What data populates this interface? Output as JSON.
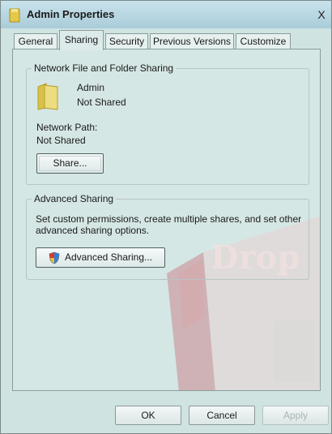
{
  "window": {
    "title": "Admin Properties",
    "close_glyph": "X"
  },
  "tabs": [
    {
      "label": "General",
      "active": false
    },
    {
      "label": "Sharing",
      "active": true
    },
    {
      "label": "Security",
      "active": false
    },
    {
      "label": "Previous Versions",
      "active": false
    },
    {
      "label": "Customize",
      "active": false
    }
  ],
  "network_sharing": {
    "group_title": "Network File and Folder Sharing",
    "folder_name": "Admin",
    "folder_status": "Not Shared",
    "network_path_label": "Network Path:",
    "network_path_value": "Not Shared",
    "share_button": "Share..."
  },
  "advanced_sharing": {
    "group_title": "Advanced Sharing",
    "description_line1": "Set custom permissions, create multiple shares, and set other",
    "description_line2": "advanced sharing options.",
    "button_label": "Advanced Sharing..."
  },
  "footer": {
    "ok": "OK",
    "cancel": "Cancel",
    "apply": "Apply"
  },
  "watermark_text": "Drop",
  "colors": {
    "background": "#cfe3e1",
    "watermark_red": "#c7505b",
    "folder_yellow": "#e8d56a"
  },
  "icons": {
    "folder": "folder-icon",
    "shield": "shield-icon",
    "close": "close-icon"
  }
}
